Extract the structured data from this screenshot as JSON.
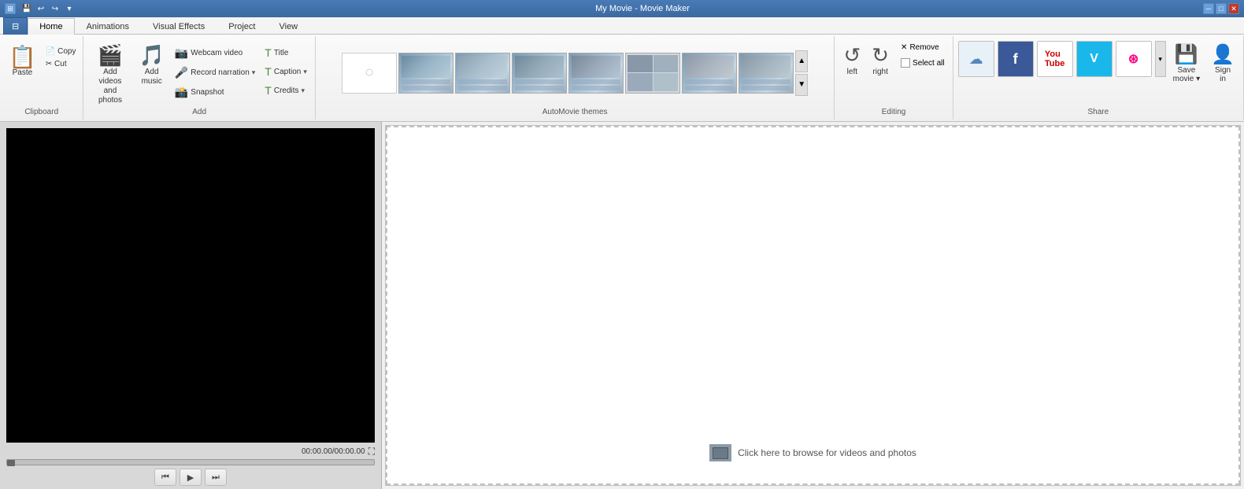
{
  "titlebar": {
    "title": "My Movie - Movie Maker",
    "quickaccess": [
      "⊡",
      "↩",
      "↪",
      "▾"
    ]
  },
  "tabs": [
    {
      "label": "Home",
      "active": true
    },
    {
      "label": "Animations",
      "active": false
    },
    {
      "label": "Visual Effects",
      "active": false
    },
    {
      "label": "Project",
      "active": false
    },
    {
      "label": "View",
      "active": false
    }
  ],
  "groups": {
    "clipboard": {
      "label": "Clipboard",
      "paste": "Paste",
      "copy": "Copy",
      "cut": "Cut"
    },
    "add": {
      "label": "Add",
      "add_videos": "Add videos",
      "and_photos": "and photos",
      "add_music": "Add",
      "music": "music",
      "webcam_video": "Webcam video",
      "record_narration": "Record narration",
      "snapshot": "Snapshot",
      "title": "Title",
      "caption": "Caption",
      "credits": "Credits"
    },
    "themes": {
      "label": "AutoMovie themes"
    },
    "editing": {
      "label": "Editing",
      "rotate_left": "left",
      "rotate_right": "right",
      "remove": "Remove",
      "select_all": "Select all"
    },
    "share": {
      "label": "Share",
      "save_movie": "Save\nmovie",
      "sign_in": "Sign\nin"
    }
  },
  "preview": {
    "time": "00:00.00/00:00.00"
  },
  "storyboard": {
    "hint": "Click here to browse for videos and photos"
  }
}
